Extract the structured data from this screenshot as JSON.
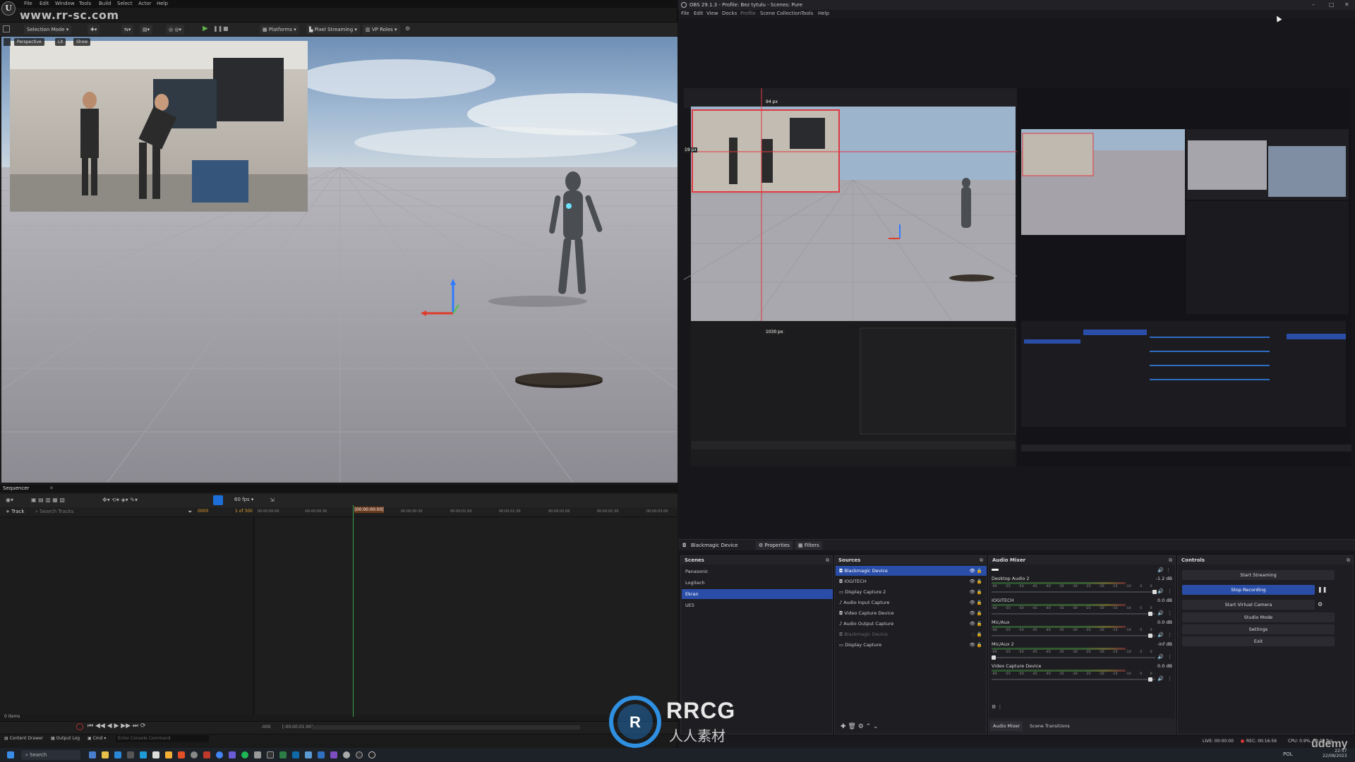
{
  "watermark_top": "www.rr-sc.com",
  "watermark_logo": "RRCG",
  "watermark_sub": "人人素材",
  "udemy": "ûdemy",
  "ue": {
    "logo": "U",
    "menu": [
      "File",
      "Edit",
      "Window",
      "Tools",
      "Build",
      "Select",
      "Actor",
      "Help"
    ],
    "toolbar": {
      "mode": "Selection Mode",
      "platforms": "Platforms",
      "pixel_streaming": "Pixel Streaming",
      "vp_roles": "VP Roles"
    },
    "viewport": {
      "perspective": "Perspective",
      "lit": "Lit",
      "show": "Show"
    },
    "sequencer": {
      "tab": "Sequencer",
      "fps": "60 fps",
      "add_track": "+ Track",
      "search_placeholder": "Search Tracks",
      "frame_start": "0000",
      "frame_of": "1 of 300",
      "playhead_time": "[00:00:00:00]",
      "ticks": [
        "00:00:00:00",
        "-00:00:00:30",
        "00:00:00:30",
        "00:00:01:00",
        "00:00:01:30",
        "00:00:02:00",
        "00:00:02:30",
        "00:00:03:00"
      ],
      "items_count": "0 items",
      "bottom_start": "-000",
      "bottom_range": "[-00:00:01:00]"
    },
    "status": {
      "content_drawer": "Content Drawer",
      "output_log": "Output Log",
      "cmd": "Cmd",
      "console_placeholder": "Enter Console Command"
    }
  },
  "obs": {
    "title": "OBS 29.1.3 - Profile: Bez tytułu - Scenes: Pure",
    "menu": [
      "File",
      "Edit",
      "View",
      "Docks",
      "Profile",
      "Scene Collection",
      "Tools",
      "Help"
    ],
    "window_controls": [
      "–",
      "□",
      "✕"
    ],
    "preview_labels": {
      "px_top": "94 px",
      "px_left": "19 px",
      "px_bottom": "1030 px"
    },
    "source_bar": {
      "source": "Blackmagic Device",
      "properties": "Properties",
      "filters": "Filters"
    },
    "scenes": {
      "title": "Scenes",
      "items": [
        "Panasonic",
        "Logitech",
        "Ekran",
        "UE5"
      ],
      "selected": 2
    },
    "sources": {
      "title": "Sources",
      "items": [
        "Blackmagic Device",
        "IOGITECH",
        "Display Capture 2",
        "Audio Input Capture",
        "Video Capture Device",
        "Audio Output Capture",
        "Blackmagic Device",
        "Display Capture"
      ],
      "selected": 0
    },
    "audio_mixer": {
      "title": "Audio Mixer",
      "channels": [
        {
          "name": "",
          "db": ""
        },
        {
          "name": "Desktop Audio 2",
          "db": "-1.2 dB"
        },
        {
          "name": "IOGITECH",
          "db": "0.0 dB"
        },
        {
          "name": "Mic/Aux",
          "db": "0.0 dB"
        },
        {
          "name": "Mic/Aux 2",
          "db": "-inf dB"
        },
        {
          "name": "Video Capture Device",
          "db": "0.0 dB"
        }
      ],
      "scale": [
        "-60",
        "-55",
        "-50",
        "-45",
        "-40",
        "-35",
        "-30",
        "-25",
        "-20",
        "-15",
        "-10",
        "-5",
        "0"
      ],
      "tabs": [
        "Audio Mixer",
        "Scene Transitions"
      ]
    },
    "controls": {
      "title": "Controls",
      "buttons": [
        "Start Streaming",
        "Stop Recording",
        "Start Virtual Camera",
        "Studio Mode",
        "Settings",
        "Exit"
      ]
    },
    "status": {
      "live": "LIVE: 00:00:00",
      "rec": "REC: 00:16:56",
      "cpu": "CPU: 0.9%, 60.00 fps"
    }
  },
  "taskbar": {
    "search": "Search",
    "lang": "POL",
    "time": "22:57",
    "date": "22/08/2023"
  }
}
